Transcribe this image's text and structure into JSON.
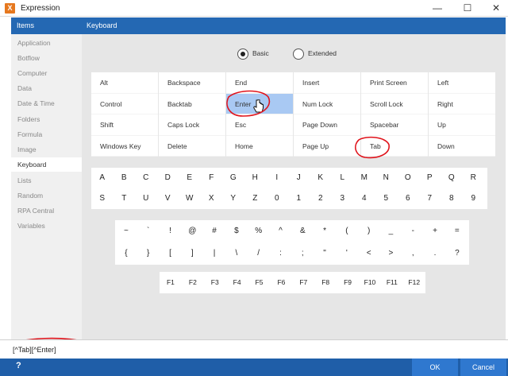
{
  "window": {
    "title": "Expression",
    "app_icon_glyph": "X",
    "minimize": "—",
    "maximize": "☐",
    "close": "✕"
  },
  "sidebar": {
    "header": "Items",
    "items": [
      {
        "label": "Application"
      },
      {
        "label": "Botflow"
      },
      {
        "label": "Computer"
      },
      {
        "label": "Data"
      },
      {
        "label": "Date & Time"
      },
      {
        "label": "Folders"
      },
      {
        "label": "Formula"
      },
      {
        "label": "Image"
      },
      {
        "label": "Keyboard"
      },
      {
        "label": "Lists"
      },
      {
        "label": "Random"
      },
      {
        "label": "RPA Central"
      },
      {
        "label": "Variables"
      }
    ],
    "active": "Keyboard"
  },
  "main": {
    "header": "Keyboard",
    "mode": {
      "basic_label": "Basic",
      "extended_label": "Extended",
      "selected": "Basic"
    },
    "special_keys": [
      "Alt",
      "Backspace",
      "End",
      "Insert",
      "Print Screen",
      "Left",
      "Control",
      "Backtab",
      "Enter",
      "Num Lock",
      "Scroll Lock",
      "Right",
      "Shift",
      "Caps Lock",
      "Esc",
      "Page Down",
      "Spacebar",
      "Up",
      "Windows Key",
      "Delete",
      "Home",
      "Page Up",
      "Tab",
      "Down"
    ],
    "highlighted_key": "Enter",
    "char_keys": [
      "A",
      "B",
      "C",
      "D",
      "E",
      "F",
      "G",
      "H",
      "I",
      "J",
      "K",
      "L",
      "M",
      "N",
      "O",
      "P",
      "Q",
      "R",
      "S",
      "T",
      "U",
      "V",
      "W",
      "X",
      "Y",
      "Z",
      "0",
      "1",
      "2",
      "3",
      "4",
      "5",
      "6",
      "7",
      "8",
      "9"
    ],
    "symbol_keys": [
      "~",
      "`",
      "!",
      "@",
      "#",
      "$",
      "%",
      "^",
      "&",
      "*",
      "(",
      ")",
      "_",
      "-",
      "+",
      "=",
      "{",
      "}",
      "[",
      "]",
      "|",
      "\\",
      "/",
      ":",
      ";",
      "\"",
      "'",
      "<",
      ">",
      ",",
      ".",
      "?"
    ],
    "function_keys": [
      "F1",
      "F2",
      "F3",
      "F4",
      "F5",
      "F6",
      "F7",
      "F8",
      "F9",
      "F10",
      "F11",
      "F12"
    ]
  },
  "expression": {
    "value": "[^Tab][^Enter]"
  },
  "footer": {
    "help": "?",
    "ok": "OK",
    "cancel": "Cancel"
  },
  "colors": {
    "header_blue": "#2468b3",
    "footer_blue": "#1f5ea8",
    "button_blue": "#2f78cf",
    "highlight": "#a9c9f3",
    "annotation_red": "#e0141c",
    "app_icon_orange": "#e6781e"
  }
}
